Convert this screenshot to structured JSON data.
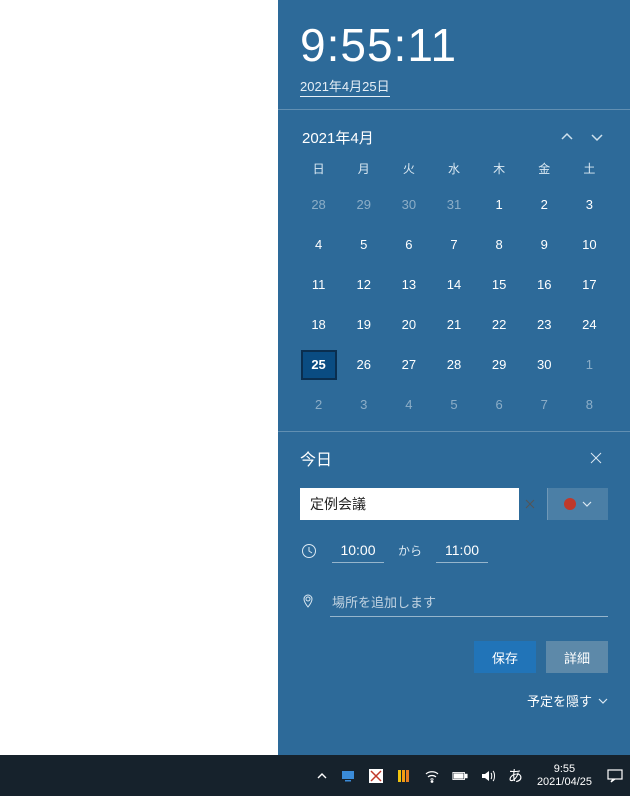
{
  "clock": {
    "h": "9",
    "m": "55",
    "s": "11"
  },
  "date_link": "2021年4月25日",
  "cal": {
    "month_label": "2021年4月",
    "dow": [
      "日",
      "月",
      "火",
      "水",
      "木",
      "金",
      "土"
    ],
    "cells": [
      {
        "n": "28",
        "out": true
      },
      {
        "n": "29",
        "out": true
      },
      {
        "n": "30",
        "out": true
      },
      {
        "n": "31",
        "out": true
      },
      {
        "n": "1"
      },
      {
        "n": "2"
      },
      {
        "n": "3"
      },
      {
        "n": "4"
      },
      {
        "n": "5"
      },
      {
        "n": "6"
      },
      {
        "n": "7"
      },
      {
        "n": "8"
      },
      {
        "n": "9"
      },
      {
        "n": "10"
      },
      {
        "n": "11"
      },
      {
        "n": "12"
      },
      {
        "n": "13"
      },
      {
        "n": "14"
      },
      {
        "n": "15"
      },
      {
        "n": "16"
      },
      {
        "n": "17"
      },
      {
        "n": "18"
      },
      {
        "n": "19"
      },
      {
        "n": "20"
      },
      {
        "n": "21"
      },
      {
        "n": "22"
      },
      {
        "n": "23"
      },
      {
        "n": "24"
      },
      {
        "n": "25",
        "today": true
      },
      {
        "n": "26"
      },
      {
        "n": "27"
      },
      {
        "n": "28"
      },
      {
        "n": "29"
      },
      {
        "n": "30"
      },
      {
        "n": "1",
        "out": true
      },
      {
        "n": "2",
        "out": true
      },
      {
        "n": "3",
        "out": true
      },
      {
        "n": "4",
        "out": true
      },
      {
        "n": "5",
        "out": true
      },
      {
        "n": "6",
        "out": true
      },
      {
        "n": "7",
        "out": true
      },
      {
        "n": "8",
        "out": true
      }
    ]
  },
  "event": {
    "heading": "今日",
    "title_value": "定例会議",
    "start_time": "10:00",
    "to_label": "から",
    "end_time": "11:00",
    "location_placeholder": "場所を追加します",
    "save_label": "保存",
    "detail_label": "詳細",
    "hide_label": "予定を隠す",
    "calendar_color": "#c0392b"
  },
  "taskbar": {
    "ime": "あ",
    "time": "9:55",
    "date": "2021/04/25"
  }
}
